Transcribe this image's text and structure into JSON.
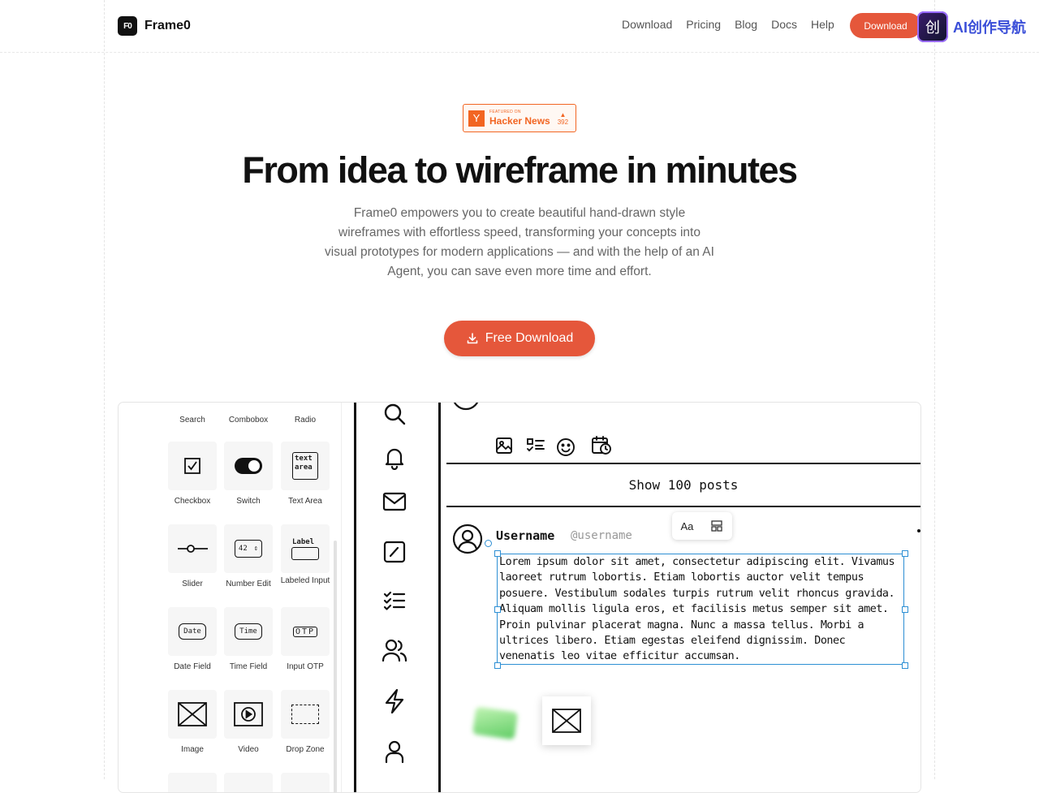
{
  "header": {
    "brand_logo": "F0",
    "brand_name": "Frame0",
    "nav": [
      "Download",
      "Pricing",
      "Blog",
      "Docs",
      "Help"
    ],
    "nav_button": "Download",
    "ad_logo": "创",
    "ad_text": "AI创作导航"
  },
  "hero": {
    "badge_small": "FEATURED ON",
    "badge_big": "Hacker News",
    "badge_votes": "392",
    "badge_letter": "Y",
    "title": "From idea to wireframe in minutes",
    "subtitle": "Frame0 empowers you to create beautiful hand-drawn style wireframes with effortless speed, transforming your concepts into visual prototypes for modern applications — and with the help of an AI Agent, you can save even more time and effort.",
    "cta": "Free Download"
  },
  "palette": {
    "top_row": [
      "Search",
      "Combobox",
      "Radio"
    ],
    "rows": [
      [
        "Checkbox",
        "Switch",
        "Text Area"
      ],
      [
        "Slider",
        "Number Edit",
        "Labeled Input"
      ],
      [
        "Date Field",
        "Time Field",
        "Input OTP"
      ],
      [
        "Image",
        "Video",
        "Drop Zone"
      ]
    ],
    "glyph_text_area": "text area",
    "glyph_number": "42",
    "glyph_label": "Label",
    "glyph_date": "Date",
    "glyph_time": "Time",
    "glyph_otp": "OTP"
  },
  "canvas": {
    "show_posts": "Show 100 posts",
    "username": "Username",
    "handle": "@username",
    "toolbar_text_icon": "Aa",
    "body": "Lorem ipsum dolor sit amet, consectetur adipiscing elit. Vivamus laoreet rutrum lobortis. Etiam lobortis auctor velit tempus posuere. Vestibulum sodales turpis rutrum velit rhoncus gravida. Aliquam mollis ligula eros, et facilisis metus semper sit amet. Proin pulvinar placerat magna. Nunc a massa tellus. Morbi a ultrices libero. Etiam egestas eleifend dignissim. Donec venenatis leo vitae efficitur accumsan."
  },
  "colors": {
    "accent": "#e5573b",
    "hn": "#f26522",
    "selection": "#2d8fd4"
  }
}
